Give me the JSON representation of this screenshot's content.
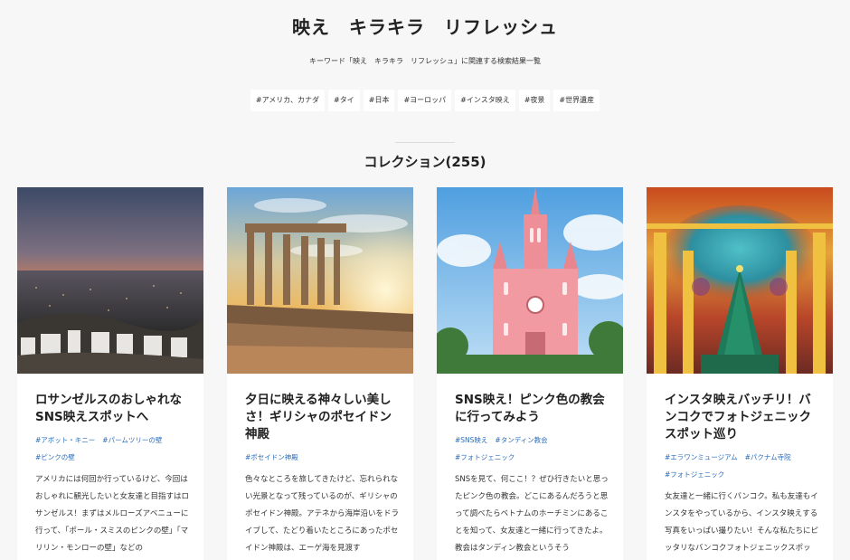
{
  "header": {
    "title": "映え　キラキラ　リフレッシュ",
    "subtitle": "キーワード「映え　キラキラ　リフレッシュ」に関連する検索結果一覧"
  },
  "tags": [
    "#アメリカ、カナダ",
    "#タイ",
    "#日本",
    "#ヨーロッパ",
    "#インスタ映え",
    "#夜景",
    "#世界遺産"
  ],
  "section": {
    "title": "コレクション(255)"
  },
  "cards": [
    {
      "title": "ロサンゼルスのおしゃれなSNS映えスポットへ",
      "tags": [
        "#アボット・キニー",
        "#パームツリーの壁",
        "#ピンクの壁"
      ],
      "text": "アメリカには何回か行っているけど、今回はおしゃれに観光したいと女友達と目指すはロサンゼルス！まずはメルローズアベニューに行って、「ポール・スミスのピンクの壁」「マリリン・モンローの壁」などの",
      "image_icon": "hollywood-hills-image"
    },
    {
      "title": "夕日に映える神々しい美しさ！ギリシャのポセイドン神殿",
      "tags": [
        "#ポセイドン神殿"
      ],
      "text": "色々なところを旅してきたけど、忘れられない光景となって残っているのが、ギリシャのポセイドン神殿。アテネから海岸沿いをドライブして、たどり着いたところにあったポセイドン神殿は、エーゲ海を見渡す",
      "image_icon": "poseidon-temple-image"
    },
    {
      "title": "SNS映え！ピンク色の教会に行ってみよう",
      "tags": [
        "#SNS映え",
        "#タンディン教会",
        "#フォトジェニック"
      ],
      "text": "SNSを見て、何ここ！？ぜひ行きたいと思ったピンク色の教会。どこにあるんだろうと思って調べたらベトナムのホーチミンにあることを知って、女友達と一緒に行ってきたよ。教会はタンディン教会というそう",
      "image_icon": "pink-church-image"
    },
    {
      "title": "インスタ映えバッチリ！バンコクでフォトジェニックスポット巡り",
      "tags": [
        "#エラワンミュージアム",
        "#パクナム寺院",
        "#フォトジェニック"
      ],
      "text": "女友達と一緒に行くバンコク。私も友達もインスタをやっているから、インスタ映えする写真をいっぱい撮りたい！そんな私たちにピッタリなバンコクフォトジェニックスポット巡り",
      "image_icon": "erawan-museum-image"
    }
  ]
}
